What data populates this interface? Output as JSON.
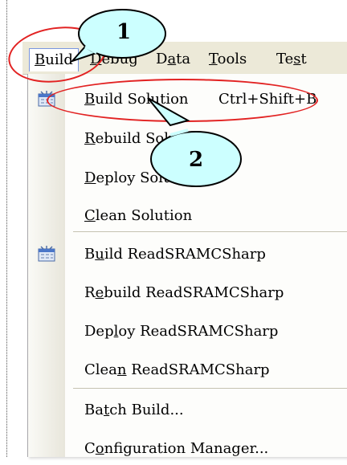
{
  "menubar": {
    "items": [
      {
        "pre": "",
        "mn": "B",
        "post": "uild"
      },
      {
        "pre": "",
        "mn": "D",
        "post": "ebug"
      },
      {
        "pre": "D",
        "mn": "a",
        "post": "ta"
      },
      {
        "pre": "",
        "mn": "T",
        "post": "ools"
      },
      {
        "pre": "Te",
        "mn": "s",
        "post": "t"
      }
    ]
  },
  "menu": {
    "items": [
      {
        "pre": "",
        "mn": "B",
        "post": "uild Solution",
        "shortcut": "Ctrl+Shift+B"
      },
      {
        "pre": "",
        "mn": "R",
        "post": "ebuild Solution"
      },
      {
        "pre": "",
        "mn": "D",
        "post": "eploy Solution"
      },
      {
        "pre": "",
        "mn": "C",
        "post": "lean Solution"
      },
      {
        "pre": "B",
        "mn": "u",
        "post": "ild ReadSRAMCSharp"
      },
      {
        "pre": "R",
        "mn": "e",
        "post": "build ReadSRAMCSharp"
      },
      {
        "pre": "Dep",
        "mn": "l",
        "post": "oy ReadSRAMCSharp"
      },
      {
        "pre": "Clea",
        "mn": "n",
        "post": " ReadSRAMCSharp"
      },
      {
        "pre": "Ba",
        "mn": "t",
        "post": "ch Build..."
      },
      {
        "pre": "C",
        "mn": "o",
        "post": "nfiguration Manager..."
      }
    ]
  },
  "callouts": {
    "one": "1",
    "two": "2"
  },
  "colors": {
    "callout_fill": "#ccffff",
    "callout_stroke": "#000000",
    "highlight": "#e22222"
  }
}
